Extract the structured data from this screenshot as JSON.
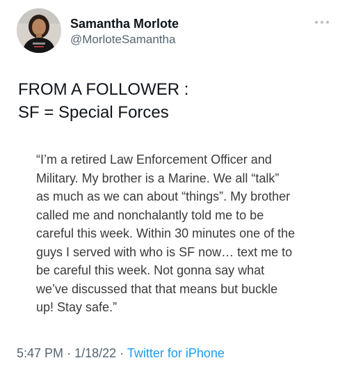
{
  "user": {
    "display_name": "Samantha Morlote",
    "handle": "@MorloteSamantha",
    "avatar_icon": "profile-photo"
  },
  "tweet": {
    "headline_lines": [
      "FROM A FOLLOWER :",
      "SF = Special Forces"
    ],
    "quote_lines": [
      "“I’m a retired Law Enforcement Officer and",
      "Military. My brother is a Marine. We all “talk”",
      "as much as we can about “things”. My brother",
      "called me and nonchalantly told me to be",
      "careful this week. Within 30 minutes one of the",
      "guys I served with who is SF now… text me to",
      "be careful this week. Not gonna say what",
      "we’ve discussed that that means but buckle",
      "up! Stay safe.”"
    ]
  },
  "meta": {
    "time": "5:47 PM",
    "separator": "·",
    "date": "1/18/22",
    "source": "Twitter for iPhone"
  },
  "colors": {
    "text_primary": "#0f1419",
    "text_secondary": "#536471",
    "link": "#1d9bf0",
    "more_dots": "#b6bec5"
  }
}
